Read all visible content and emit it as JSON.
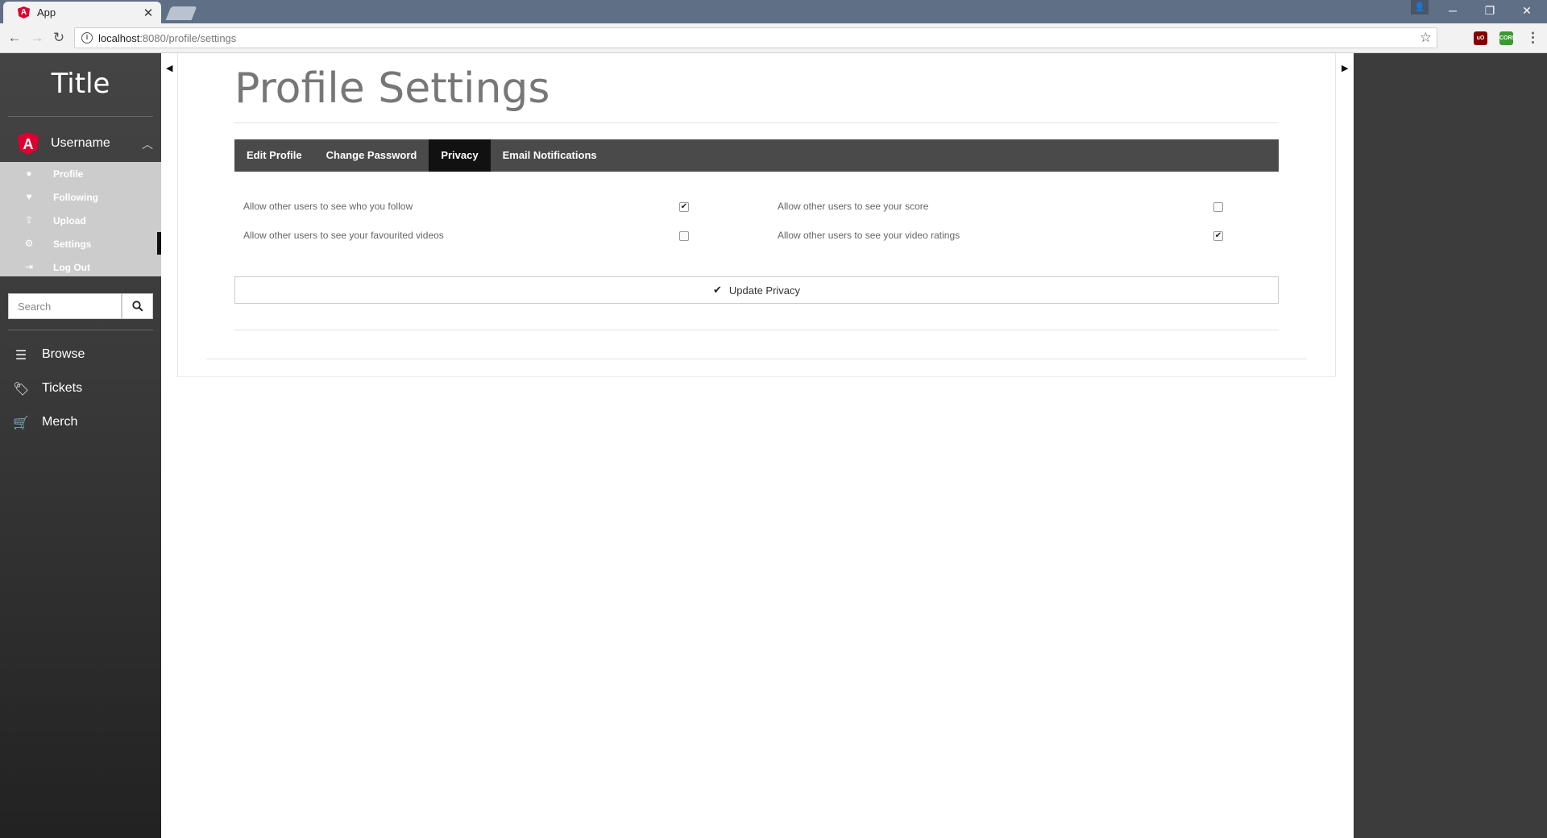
{
  "browser": {
    "tab_title": "App",
    "url_host": "localhost",
    "url_rest": ":8080/profile/settings",
    "ext1_label": "uO",
    "ext2_label": "CORS"
  },
  "sidebar": {
    "title": "Title",
    "username": "Username",
    "submenu": [
      {
        "label": "Profile",
        "icon": "user-icon"
      },
      {
        "label": "Following",
        "icon": "heart-icon"
      },
      {
        "label": "Upload",
        "icon": "upload-icon"
      },
      {
        "label": "Settings",
        "icon": "gear-icon"
      },
      {
        "label": "Log Out",
        "icon": "sign-out-icon"
      }
    ],
    "search_placeholder": "Search",
    "nav": [
      {
        "label": "Browse",
        "icon": "bars-icon"
      },
      {
        "label": "Tickets",
        "icon": "ticket-icon"
      },
      {
        "label": "Merch",
        "icon": "cart-icon"
      }
    ]
  },
  "main": {
    "page_title": "Profile Settings",
    "tabs": [
      {
        "label": "Edit Profile",
        "active": false
      },
      {
        "label": "Change Password",
        "active": false
      },
      {
        "label": "Privacy",
        "active": true
      },
      {
        "label": "Email Notifications",
        "active": false
      }
    ],
    "options": [
      {
        "label": "Allow other users to see who you follow",
        "checked": true
      },
      {
        "label": "Allow other users to see your score",
        "checked": false
      },
      {
        "label": "Allow other users to see your favourited videos",
        "checked": false
      },
      {
        "label": "Allow other users to see your video ratings",
        "checked": true
      }
    ],
    "update_label": "Update Privacy"
  },
  "colors": {
    "angular_red": "#dd0031",
    "tab_active": "#111111",
    "tab_bar": "#4a4a4a"
  }
}
